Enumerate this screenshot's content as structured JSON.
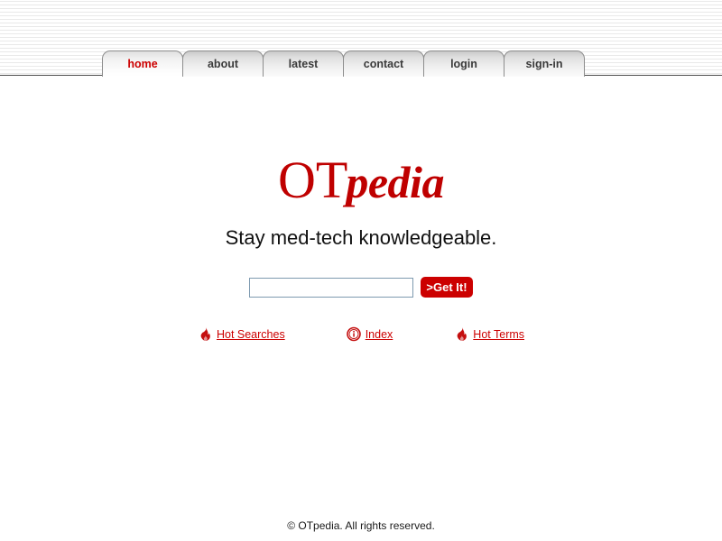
{
  "site": {
    "logo_primary": "OT",
    "logo_secondary": "pedia",
    "tagline": "Stay med-tech knowledgeable.",
    "brand_color": "#bf0000",
    "accent_color": "#cc0000"
  },
  "nav": {
    "tabs": [
      {
        "label": "home",
        "active": true
      },
      {
        "label": "about",
        "active": false
      },
      {
        "label": "latest",
        "active": false
      },
      {
        "label": "contact",
        "active": false
      },
      {
        "label": "login",
        "active": false
      },
      {
        "label": "sign-in",
        "active": false
      }
    ]
  },
  "search": {
    "value": "",
    "placeholder": "",
    "button_label": ">Get It!"
  },
  "quick_links": [
    {
      "label": "Hot Searches",
      "icon": "flame-icon"
    },
    {
      "label": "Index",
      "icon": "info-circle-icon"
    },
    {
      "label": "Hot Terms",
      "icon": "flame-icon"
    }
  ],
  "footer": {
    "copyright": "© OTpedia. All rights reserved."
  }
}
